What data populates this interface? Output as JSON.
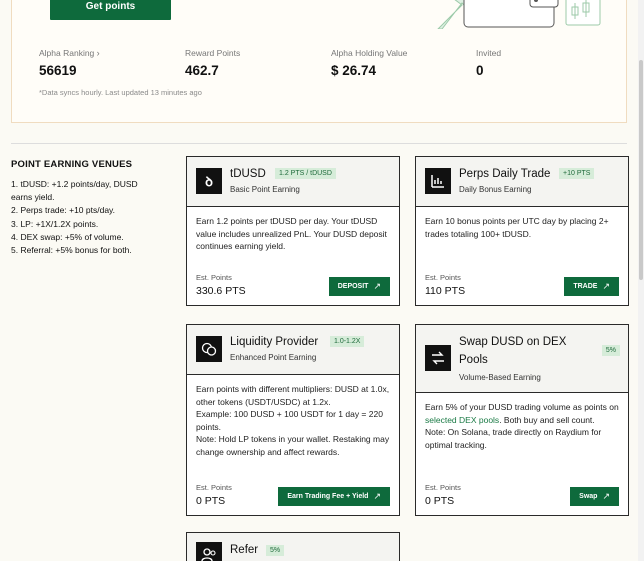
{
  "summary": {
    "get_points_label": "Get points",
    "stats": [
      {
        "label": "Alpha Ranking",
        "value": "56619",
        "has_chevron": true
      },
      {
        "label": "Reward Points",
        "value": "462.7"
      },
      {
        "label": "Alpha Holding Value",
        "value": "$ 26.74"
      },
      {
        "label": "Invited",
        "value": "0"
      }
    ],
    "sync_note": "*Data syncs hourly. Last updated 13 minutes ago"
  },
  "venues": {
    "title": "POINT EARNING VENUES",
    "items": [
      "1. tDUSD: +1.2 points/day, DUSD earns yield.",
      "2. Perps trade: +10 pts/day.",
      "3. LP: +1X/1.2X points.",
      "4. DEX swap: +5% of volume.",
      "5. Referral: +5% bonus for both."
    ]
  },
  "cards": {
    "tdusd": {
      "title": "tDUSD",
      "badge": "1.2 PTS / tDUSD",
      "subtitle": "Basic Point Earning",
      "body": "Earn 1.2 points per tDUSD per day. Your tDUSD value includes unrealized PnL. Your DUSD deposit continues earning yield.",
      "est_label": "Est. Points",
      "est_value": "330.6 PTS",
      "action": "DEPOSIT"
    },
    "perps": {
      "title": "Perps Daily Trade",
      "badge": "+10 PTS",
      "subtitle": "Daily Bonus Earning",
      "body": "Earn 10 bonus points per UTC day by placing 2+ trades totaling 100+ tDUSD.",
      "est_label": "Est. Points",
      "est_value": "110 PTS",
      "action": "TRADE"
    },
    "lp": {
      "title": "Liquidity Provider",
      "badge": "1.0-1.2X",
      "subtitle": "Enhanced Point Earning",
      "body_1": "Earn points with different multipliers: DUSD at 1.0x, other tokens (USDT/USDC) at 1.2x.",
      "body_2": "Example: 100 DUSD + 100 USDT for 1 day = 220 points.",
      "body_3": "Note: Hold LP tokens in your wallet. Restaking may change ownership and affect rewards.",
      "est_label": "Est. Points",
      "est_value": "0 PTS",
      "action": "Earn Trading Fee + Yield"
    },
    "swap": {
      "title": "Swap DUSD on DEX Pools",
      "badge": "5%",
      "subtitle": "Volume-Based Earning",
      "body_pre": "Earn 5% of your DUSD trading volume as points on ",
      "body_link": "selected DEX pools",
      "body_post": ". Both buy and sell count.",
      "body_note": "Note: On Solana, trade directly on Raydium for optimal tracking.",
      "est_label": "Est. Points",
      "est_value": "0 PTS",
      "action": "Swap"
    },
    "refer": {
      "title": "Refer",
      "badge": "5%"
    }
  },
  "colors": {
    "accent_green": "#0e6a3c",
    "badge_bg": "#d6ecd9",
    "summary_border": "#f0dcc0",
    "page_bg": "#fbfaf4"
  }
}
